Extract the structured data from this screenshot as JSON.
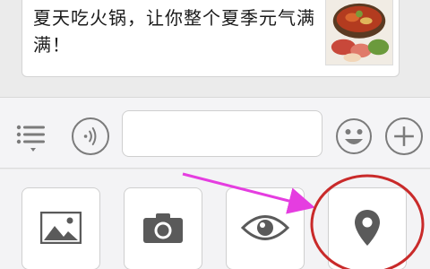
{
  "chat": {
    "message_text": "夏天吃火锅，让你整个夏季元气满满！",
    "thumbnail_icon": "hotpot-photo"
  },
  "input_bar": {
    "menu_icon": "menu-list-icon",
    "voice_icon": "voice-icon",
    "input_value": "",
    "emoji_icon": "emoji-icon",
    "plus_icon": "plus-icon"
  },
  "panel": {
    "tools": [
      {
        "icon": "image-icon"
      },
      {
        "icon": "camera-icon"
      },
      {
        "icon": "eye-icon"
      },
      {
        "icon": "location-pin-icon"
      }
    ]
  },
  "annotation": {
    "arrow_color": "#e53de0",
    "circle_color": "#c92a2a"
  }
}
